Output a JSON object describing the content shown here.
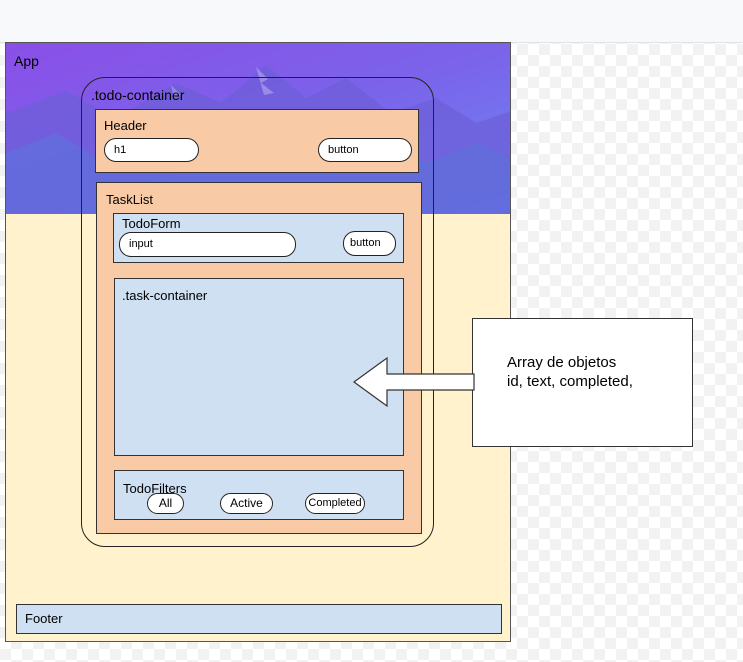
{
  "diagram": {
    "app": {
      "label": "App"
    },
    "todo_container": {
      "label": ".todo-container"
    },
    "header": {
      "label": "Header",
      "h1": "h1",
      "button": "button"
    },
    "task_list": {
      "label": "TaskList"
    },
    "todo_form": {
      "label": "TodoForm",
      "input": "input",
      "button": "button"
    },
    "task_container": {
      "label": ".task-container"
    },
    "todo_filters": {
      "label": "TodoFilters",
      "all": "All",
      "active": "Active",
      "completed": "Completed"
    },
    "footer": {
      "label": "Footer"
    },
    "note": {
      "line1": "Array de objetos",
      "line2": "id, text, completed,"
    }
  },
  "colors": {
    "app_bg": "#fff2cc",
    "component_bg": "#f8cba6",
    "inner_bg": "#cfe0f2",
    "banner_top": "#7b55e6",
    "banner_bottom": "#6a7df0"
  }
}
